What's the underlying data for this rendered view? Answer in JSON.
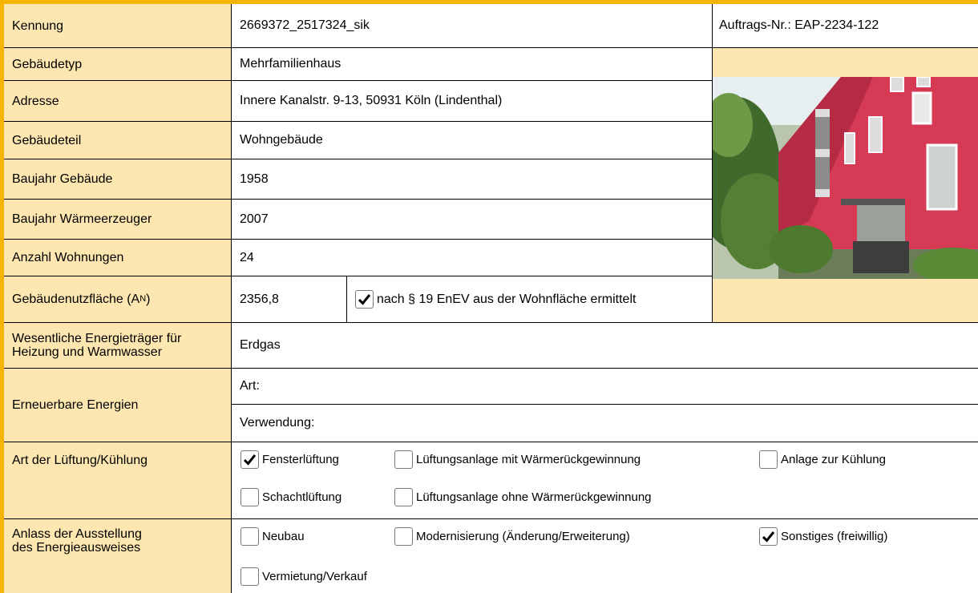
{
  "header": {
    "auftrag": "Auftrags-Nr.: EAP-2234-122"
  },
  "fields": {
    "kennung": {
      "label": "Kennung",
      "value": "2669372_2517324_sik"
    },
    "gebaeudetyp": {
      "label": "Gebäudetyp",
      "value": "Mehrfamilienhaus"
    },
    "adresse": {
      "label": "Adresse",
      "value": "Innere Kanalstr. 9-13, 50931 Köln (Lindenthal)"
    },
    "gebaeudeteil": {
      "label": "Gebäudeteil",
      "value": "Wohngebäude"
    },
    "baujahr_gebaeude": {
      "label": "Baujahr Gebäude",
      "value": "1958"
    },
    "baujahr_waermeerzeuger": {
      "label": "Baujahr Wärmeerzeuger",
      "value": "2007"
    },
    "anzahl_wohnungen": {
      "label": "Anzahl Wohnungen",
      "value": "24"
    },
    "nutzflaeche": {
      "label": "Gebäudenutzfläche (A",
      "label_sub": "N",
      "label_end": ")",
      "value": "2356,8",
      "check_label": "nach § 19 EnEV aus der Wohnfläche ermittelt",
      "checked": true
    },
    "energietraeger": {
      "label_line1": "Wesentliche Energieträger für",
      "label_line2": "Heizung und Warmwasser",
      "value": "Erdgas"
    },
    "erneuerbare": {
      "label": "Erneuerbare Energien",
      "art": "Art:",
      "verwendung": "Verwendung:"
    },
    "lueftung": {
      "label": "Art der Lüftung/Kühlung",
      "options": [
        {
          "label": "Fensterlüftung",
          "checked": true
        },
        {
          "label": "Lüftungsanlage mit Wärmerückgewinnung",
          "checked": false
        },
        {
          "label": "Anlage zur Kühlung",
          "checked": false
        },
        {
          "label": "Schachtlüftung",
          "checked": false
        },
        {
          "label": "Lüftungsanlage ohne Wärmerückgewinnung",
          "checked": false
        }
      ]
    },
    "anlass": {
      "label_line1": "Anlass der Ausstellung",
      "label_line2": "des Energieausweises",
      "options": [
        {
          "label": "Neubau",
          "checked": false
        },
        {
          "label": "Modernisierung (Änderung/Erweiterung)",
          "checked": false
        },
        {
          "label": "Sonstiges (freiwillig)",
          "checked": true
        },
        {
          "label": "Vermietung/Verkauf",
          "checked": false
        }
      ]
    }
  },
  "colors": {
    "label_bg": "#fde6b0",
    "accent": "#f4b400",
    "facade": "#d63a55"
  },
  "photo_icon": "building-photo"
}
